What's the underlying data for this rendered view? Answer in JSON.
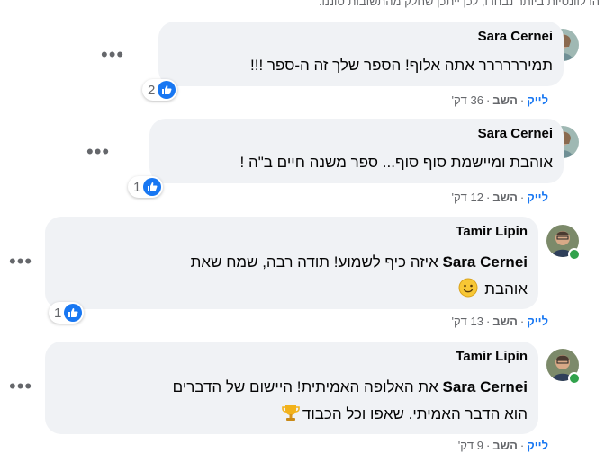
{
  "top_note": "הרלוונטיות ביותר נבחרו, לכן ייתכן שחלק מהתשובות סוננו.",
  "comments": [
    {
      "author": "Sara Cernei",
      "line1": "תמירררררר אתה אלוף! הספר שלך זה ה-ספר !!!",
      "reactions": "2",
      "like_label": "לייק",
      "reply_label": "השב",
      "time": "36 דק'"
    },
    {
      "author": "Sara Cernei",
      "line1": "אוהבת ומיישמת סוף סוף... ספר משנה חיים ב\"ה !",
      "reactions": "1",
      "like_label": "לייק",
      "reply_label": "השב",
      "time": "12 דק'"
    },
    {
      "author": "Tamir Lipin",
      "mention": "Sara Cernei",
      "line1_after": " איזה כיף לשמוע! תודה רבה, שמח שאת",
      "line2": "אוהבת",
      "reactions": "1",
      "like_label": "לייק",
      "reply_label": "השב",
      "time": "13 דק'"
    },
    {
      "author": "Tamir Lipin",
      "mention": "Sara Cernei",
      "line1_after": " את האלופה האמיתית! היישום של הדברים",
      "line2": "הוא הדבר האמיתי. שאפו וכל הכבוד",
      "like_label": "לייק",
      "reply_label": "השב",
      "time": "9 דק'"
    }
  ],
  "colors": {
    "bubble": "#f0f2f5",
    "like_blue": "#1877f2",
    "muted": "#65676b",
    "online": "#31a24c"
  },
  "icons": [
    "like-thumb-icon",
    "more-options-icon",
    "smile-emoji-icon",
    "trophy-emoji-icon"
  ]
}
